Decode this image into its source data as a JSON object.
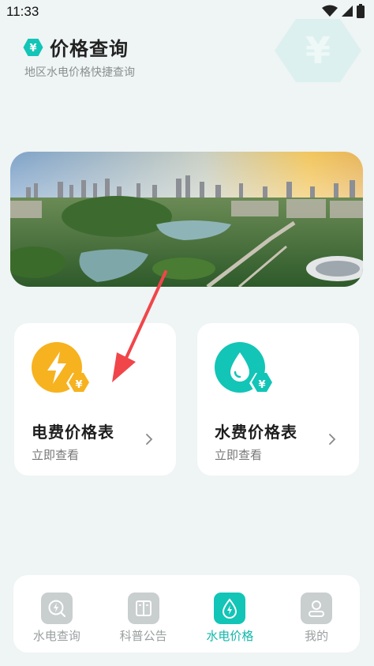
{
  "status_bar": {
    "time": "11:33"
  },
  "header": {
    "title": "价格查询",
    "subtitle": "地区水电价格快捷查询",
    "badge_symbol": "¥"
  },
  "cards": [
    {
      "id": "electricity",
      "title": "电费价格表",
      "subtitle": "立即查看",
      "badge_symbol": "¥",
      "icon": "lightning-icon"
    },
    {
      "id": "water",
      "title": "水费价格表",
      "subtitle": "立即查看",
      "badge_symbol": "¥",
      "icon": "water-drop-icon"
    }
  ],
  "bottom_nav": {
    "items": [
      {
        "label": "水电查询",
        "icon": "search-bolt-icon",
        "active": false
      },
      {
        "label": "科普公告",
        "icon": "book-icon",
        "active": false
      },
      {
        "label": "水电价格",
        "icon": "water-bolt-icon",
        "active": true
      },
      {
        "label": "我的",
        "icon": "user-icon",
        "active": false
      }
    ]
  },
  "colors": {
    "accent": "#12c5b7",
    "electric": "#f7b21f",
    "background": "#eff4f4",
    "annotation": "#f0464a"
  }
}
